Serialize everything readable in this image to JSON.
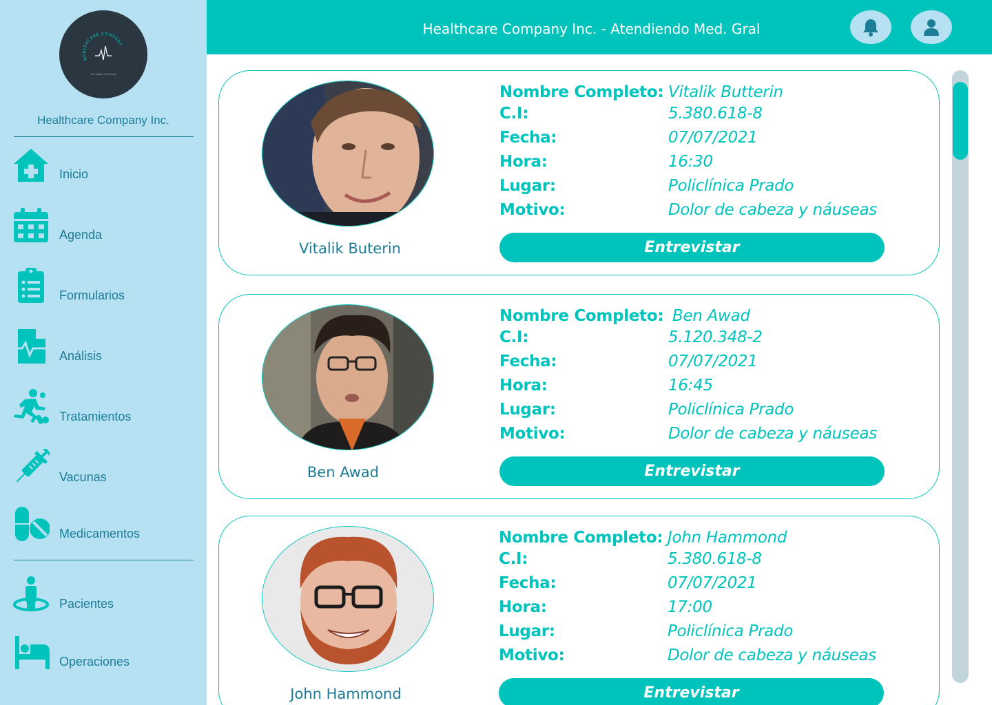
{
  "colors": {
    "accent": "#00c4bc",
    "sidebar_bg": "#b6e1f3",
    "text_blue": "#1d7d97",
    "logo_bg": "#2b3740",
    "scroll_track": "#c3d5dc"
  },
  "sidebar": {
    "logo": {
      "arc_text": "HEALTHCARE COMPANY",
      "tagline": "Your Health Our Priority"
    },
    "company_name": "Healthcare Company Inc.",
    "items": [
      {
        "label": "Inicio",
        "icon": "hospital-home-icon"
      },
      {
        "label": "Agenda",
        "icon": "calendar-icon"
      },
      {
        "label": "Formularios",
        "icon": "clipboard-list-icon"
      },
      {
        "label": "Análisis",
        "icon": "medical-file-icon"
      },
      {
        "label": "Tratamientos",
        "icon": "running-pills-icon"
      },
      {
        "label": "Vacunas",
        "icon": "syringe-icon"
      },
      {
        "label": "Medicamentos",
        "icon": "pills-icon"
      }
    ],
    "items_secondary": [
      {
        "label": "Pacientes",
        "icon": "patient-icon"
      },
      {
        "label": "Operaciones",
        "icon": "hospital-bed-icon"
      }
    ]
  },
  "header": {
    "title": "Healthcare Company Inc. - Atendiendo Med. Gral",
    "notification_icon": "bell-icon",
    "profile_icon": "user-icon"
  },
  "labels": {
    "name": "Nombre Completo:",
    "ci": "C.I:",
    "date": "Fecha:",
    "time": "Hora:",
    "place": "Lugar:",
    "reason": "Motivo:"
  },
  "patients": [
    {
      "display_name": "Vitalik Buterin",
      "full_name": "Vitalik Butterin",
      "ci": "5.380.618-8",
      "date": "07/07/2021",
      "time": "16:30",
      "place": "Policlínica Prado",
      "reason": "Dolor de cabeza y náuseas",
      "button": "Entrevistar"
    },
    {
      "display_name": "Ben Awad",
      "full_name": "Ben Awad",
      "ci": "5.120.348-2",
      "date": "07/07/2021",
      "time": "16:45",
      "place": "Policlínica Prado",
      "reason": "Dolor de cabeza y náuseas",
      "button": "Entrevistar"
    },
    {
      "display_name": "John Hammond",
      "full_name": "John Hammond",
      "ci": "5.380.618-8",
      "date": "07/07/2021",
      "time": "17:00",
      "place": "Policlínica Prado",
      "reason": "Dolor de cabeza y náuseas",
      "button": "Entrevistar"
    }
  ]
}
